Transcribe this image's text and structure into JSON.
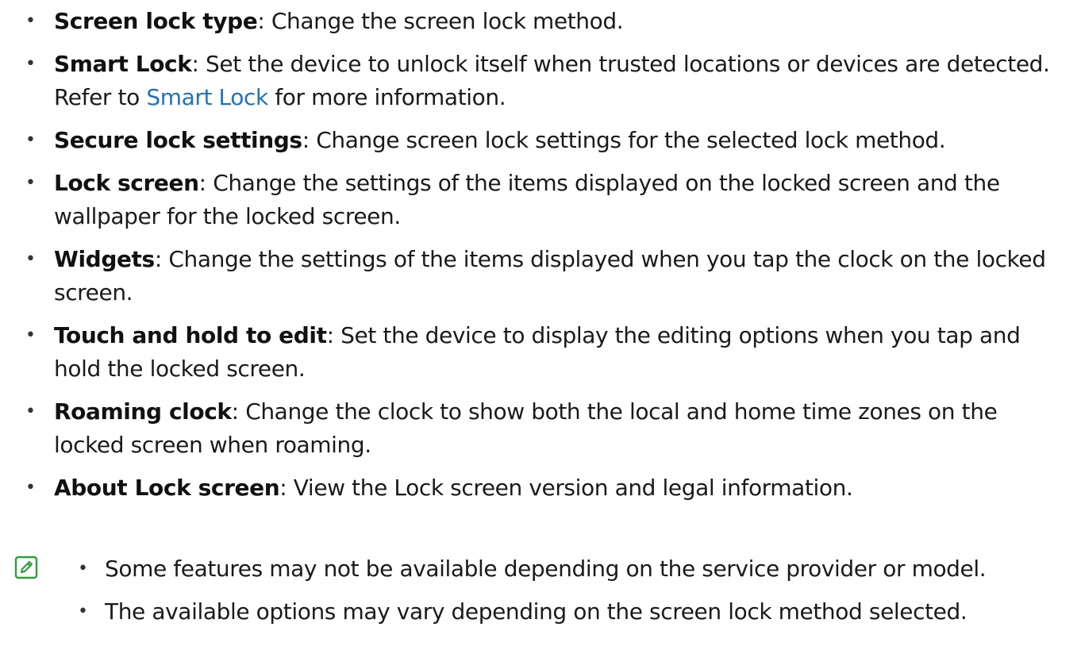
{
  "items": [
    {
      "term": "Screen lock type",
      "sep": ": ",
      "text": "Change the screen lock method."
    },
    {
      "term": "Smart Lock",
      "sep": ": ",
      "text": "Set the device to unlock itself when trusted locations or devices are detected. Refer to ",
      "link": "Smart Lock",
      "text_after": " for more information."
    },
    {
      "term": "Secure lock settings",
      "sep": ": ",
      "text": "Change screen lock settings for the selected lock method."
    },
    {
      "term": "Lock screen",
      "sep": ": ",
      "text": "Change the settings of the items displayed on the locked screen and the wallpaper for the locked screen."
    },
    {
      "term": "Widgets",
      "sep": ": ",
      "text": "Change the settings of the items displayed when you tap the clock on the locked screen."
    },
    {
      "term": "Touch and hold to edit",
      "sep": ": ",
      "text": "Set the device to display the editing options when you tap and hold the locked screen."
    },
    {
      "term": "Roaming clock",
      "sep": ": ",
      "text": "Change the clock to show both the local and home time zones on the locked screen when roaming."
    },
    {
      "term": "About Lock screen",
      "sep": ": ",
      "text": "View the Lock screen version and legal information."
    }
  ],
  "notes": [
    "Some features may not be available depending on the service provider or model.",
    "The available options may vary depending on the screen lock method selected."
  ],
  "bullet": "•",
  "icons": {
    "note": "note-pencil-icon",
    "accent": "#2e9e3a",
    "link_color": "#1e73be"
  }
}
